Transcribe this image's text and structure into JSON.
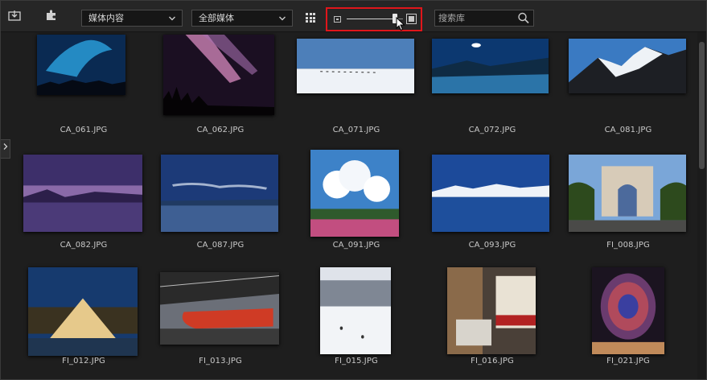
{
  "toolbar": {
    "import_icon": "import-icon",
    "puzzle_icon": "puzzle-piece-icon",
    "media_type_select": "媒体内容",
    "media_filter_select": "全部媒体",
    "grid_icon": "grid-view-icon",
    "search_placeholder": "搜索库",
    "thumbnail_size_level": 0.85,
    "highlight_color": "#e0161b"
  },
  "items": [
    {
      "name": "CA_061.JPG",
      "palette": "aurora-blue"
    },
    {
      "name": "CA_062.JPG",
      "palette": "aurora-pink"
    },
    {
      "name": "CA_071.JPG",
      "palette": "snow-sled"
    },
    {
      "name": "CA_072.JPG",
      "palette": "night-lake"
    },
    {
      "name": "CA_081.JPG",
      "palette": "snow-mountain"
    },
    {
      "name": "CA_082.JPG",
      "palette": "purple-dusk"
    },
    {
      "name": "CA_087.JPG",
      "palette": "blue-lake"
    },
    {
      "name": "CA_091.JPG",
      "palette": "clouds-meadow"
    },
    {
      "name": "CA_093.JPG",
      "palette": "mountain-reflection"
    },
    {
      "name": "FI_008.JPG",
      "palette": "arc-triomphe"
    },
    {
      "name": "FI_012.JPG",
      "palette": "louvre-pyramid"
    },
    {
      "name": "FI_013.JPG",
      "palette": "train-station"
    },
    {
      "name": "FI_015.JPG",
      "palette": "snow-plaza"
    },
    {
      "name": "FI_016.JPG",
      "palette": "street-shop"
    },
    {
      "name": "FI_021.JPG",
      "palette": "rose-window"
    }
  ]
}
